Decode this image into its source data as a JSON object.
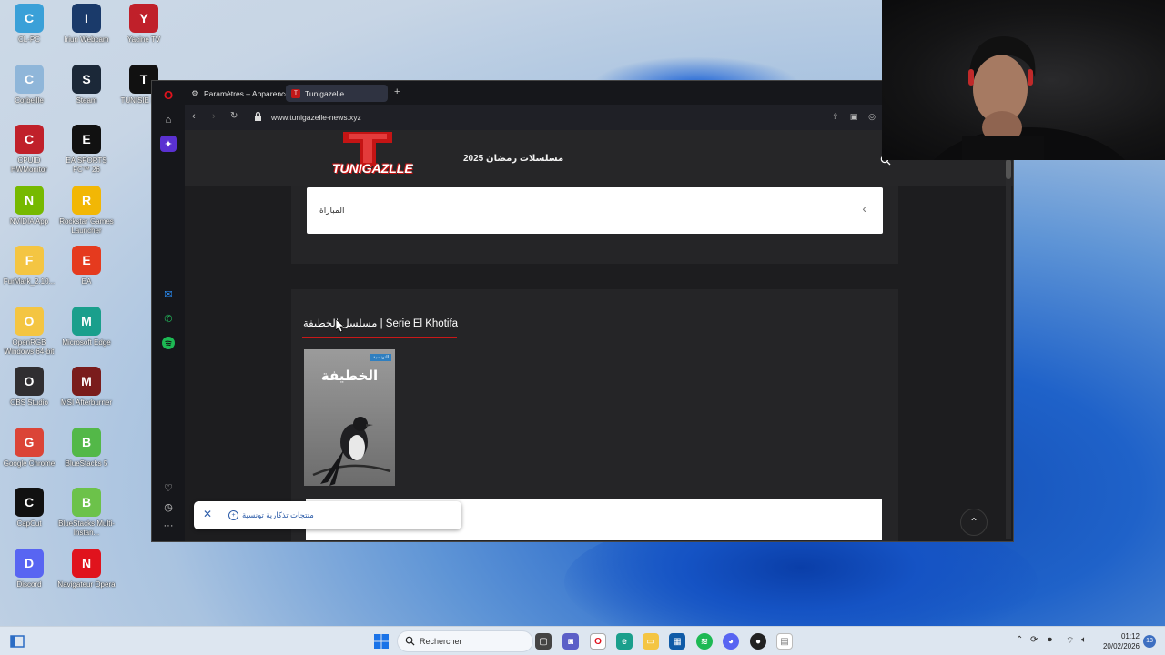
{
  "desktop": {
    "icons": [
      {
        "label": "CL-PC",
        "icon": "monitor-icon",
        "color": "#3aa0d8"
      },
      {
        "label": "Iriun Webcam",
        "icon": "webcam-icon",
        "color": "#1a3a6a"
      },
      {
        "label": "Yacine TV",
        "icon": "tv-icon",
        "color": "#c0202a"
      },
      {
        "label": "Corbeille",
        "icon": "recycle-bin-icon",
        "color": "#8fb6d9"
      },
      {
        "label": "Steam",
        "icon": "steam-icon",
        "color": "#1b2838"
      },
      {
        "label": "TUNISIE LIVE",
        "icon": "live-icon",
        "color": "#111111"
      },
      {
        "label": "CPUID HWMonitor",
        "icon": "hwmonitor-icon",
        "color": "#c0202a"
      },
      {
        "label": "EA SPORTS FC™ 26",
        "icon": "fc26-icon",
        "color": "#111111"
      },
      {
        "label": "NVIDIA App",
        "icon": "nvidia-icon",
        "color": "#76b900"
      },
      {
        "label": "Rockstar Games Launcher",
        "icon": "rockstar-icon",
        "color": "#f2b705"
      },
      {
        "label": "FurMark_2.10...",
        "icon": "folder-icon",
        "color": "#f4c542"
      },
      {
        "label": "EA",
        "icon": "ea-icon",
        "color": "#e53a1e"
      },
      {
        "label": "OpenRGB Windows 64-bit",
        "icon": "folder-icon",
        "color": "#f4c542"
      },
      {
        "label": "Microsoft Edge",
        "icon": "edge-icon",
        "color": "#1a9f8c"
      },
      {
        "label": "OBS Studio",
        "icon": "obs-icon",
        "color": "#302e31"
      },
      {
        "label": "MSI Afterburner",
        "icon": "afterburner-icon",
        "color": "#7a1c1c"
      },
      {
        "label": "Google Chrome",
        "icon": "chrome-icon",
        "color": "#db4437"
      },
      {
        "label": "BlueStacks 5",
        "icon": "bluestacks-icon",
        "color": "#53b848"
      },
      {
        "label": "CapCut",
        "icon": "capcut-icon",
        "color": "#111111"
      },
      {
        "label": "BlueStacks Multi-Instan...",
        "icon": "bluestacks-multi-icon",
        "color": "#6cc24a"
      },
      {
        "label": "Discord",
        "icon": "discord-icon",
        "color": "#5865f2"
      },
      {
        "label": "Navigateur Opera",
        "icon": "opera-icon",
        "color": "#e0131d"
      }
    ]
  },
  "browser": {
    "tabs": [
      {
        "label": "Paramètres – Apparence",
        "icon": "gear-icon"
      },
      {
        "label": "Tunigazelle",
        "icon": "tunigazelle-favicon-icon"
      }
    ],
    "url": "www.tunigazelle-news.xyz"
  },
  "site": {
    "logo_text": "TUNIGAZLLE",
    "header_title": "مسلسلات رمضان 2025",
    "card1_text": "المباراة",
    "section_title": "مسلسل الخطيفة | Serie El Khotifa",
    "poster": {
      "title": "الخطيفة",
      "badge": "التونسية"
    }
  },
  "toast": {
    "text": "منتجات تذكارية تونسية"
  },
  "taskbar": {
    "search_placeholder": "Rechercher",
    "time": "01:12",
    "date": "20/02/2026",
    "notifications": "18"
  },
  "colors": {
    "accent_red": "#c91818",
    "opera_red": "#e0131d"
  }
}
